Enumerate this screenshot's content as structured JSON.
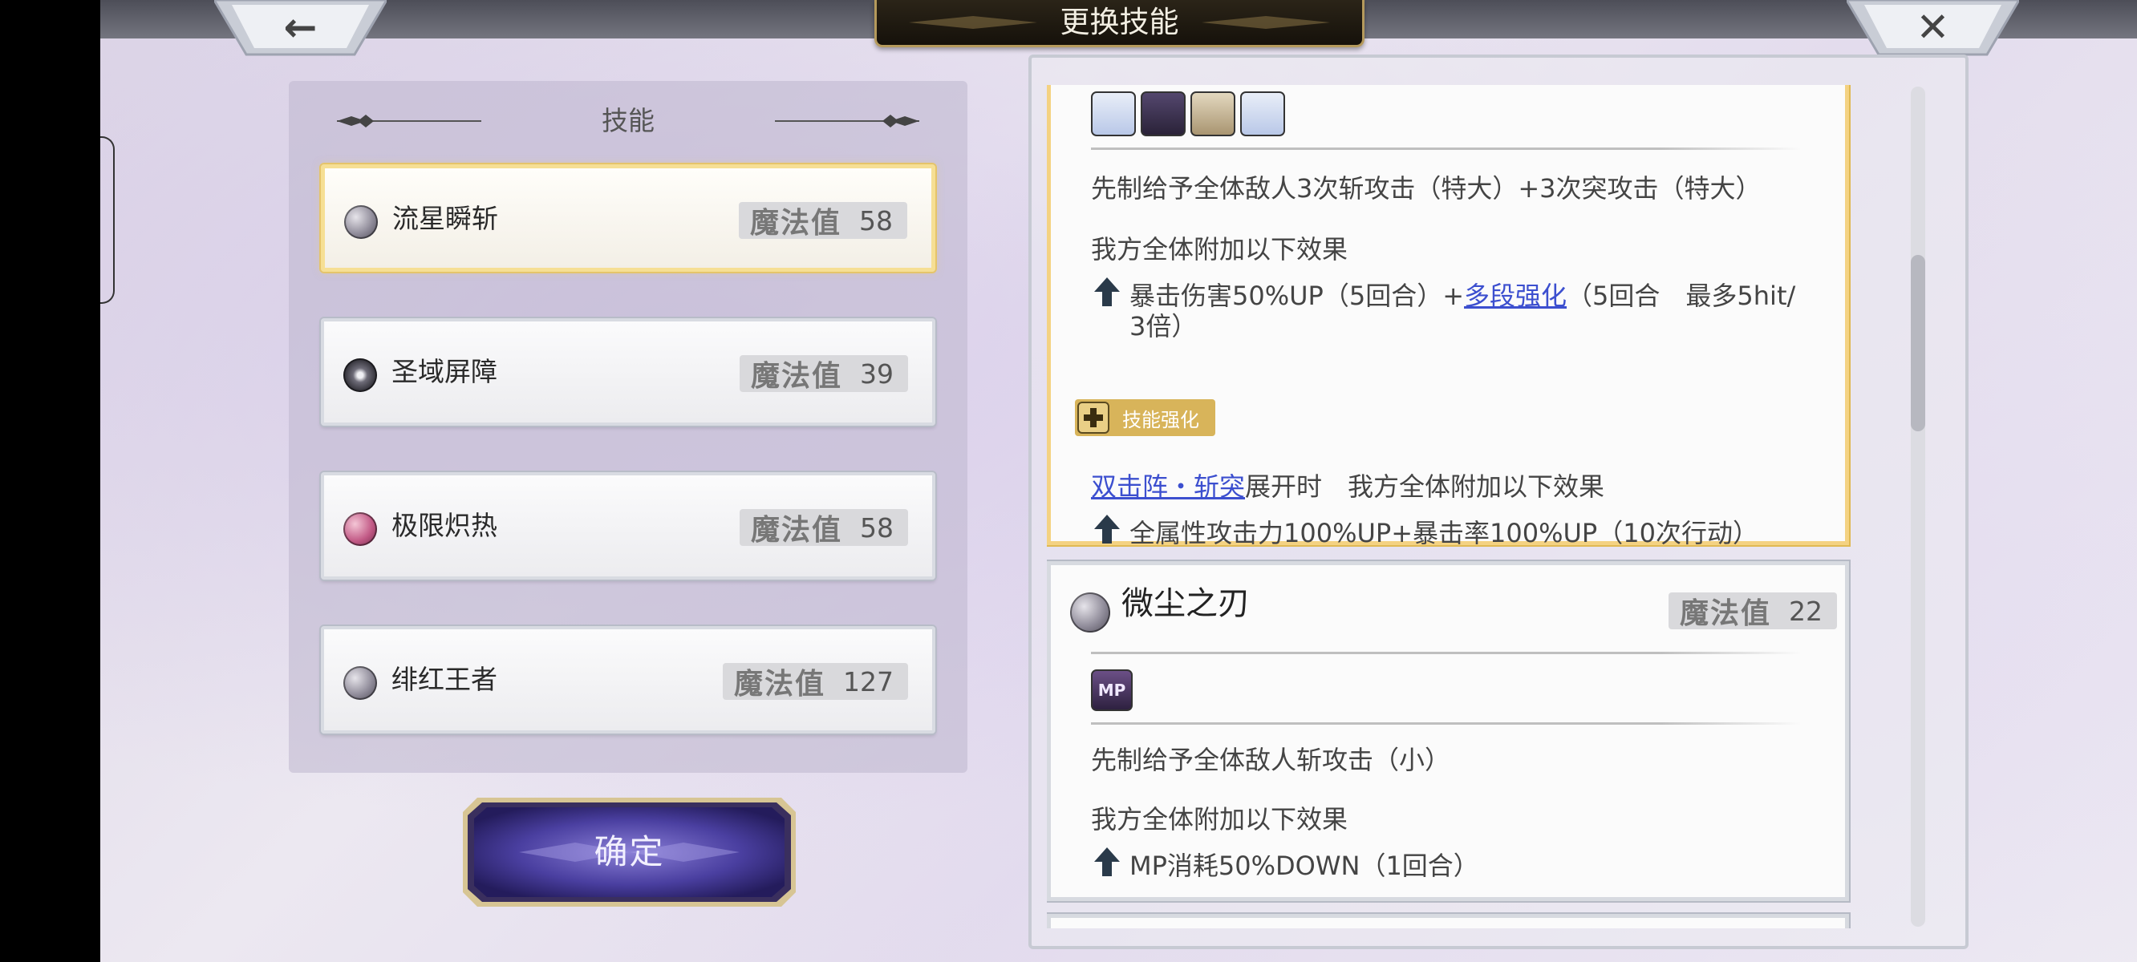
{
  "screen": {
    "title": "更换技能",
    "back_glyph": "←",
    "close_glyph": "✕"
  },
  "skill_list": {
    "header": "技能",
    "mp_label": "魔法值",
    "items": [
      {
        "name": "流星瞬斩",
        "mp": "58",
        "icon": "dark-moon-icon",
        "selected": true
      },
      {
        "name": "圣域屏障",
        "mp": "39",
        "icon": "holy-star-icon",
        "selected": false
      },
      {
        "name": "极限炽热",
        "mp": "58",
        "icon": "fire-orb-icon",
        "selected": false
      },
      {
        "name": "绯红王者",
        "mp": "127",
        "icon": "dark-moon-icon",
        "selected": false
      }
    ]
  },
  "confirm_label": "确定",
  "details": {
    "card1": {
      "effect_icons": [
        "attack-up-icon",
        "slash-icon",
        "multi-hit-icon",
        "attack-boost-icon"
      ],
      "line1": "先制给予全体敌人3次斩攻击（特大）+3次突攻击（特大）",
      "line2": "我方全体附加以下效果",
      "buff_a_prefix": "暴击伤害50%UP（5回合）+",
      "buff_a_link": "多段强化",
      "buff_a_suffix": "（5回合　最多5hit/",
      "buff_a_line2": "3倍）",
      "enhance_tag": "技能强化",
      "enh_link": "双击阵・斩突",
      "enh_text": "展开时　我方全体附加以下效果",
      "buff_b": "全属性攻击力100%UP+暴击率100%UP（10次行动）"
    },
    "card2": {
      "name": "微尘之刃",
      "mp_label": "魔法值",
      "mp": "22",
      "effect_icon": "mp-icon",
      "effect_icon_text": "MP",
      "line1": "先制给予全体敌人斩攻击（小）",
      "line2": "我方全体附加以下效果",
      "buff": "MP消耗50%DOWN（1回合）"
    }
  },
  "colors": {
    "accent_gold": "#f4d282",
    "link_blue": "#3c4fcf",
    "confirm_purple": "#4a3fa0"
  }
}
